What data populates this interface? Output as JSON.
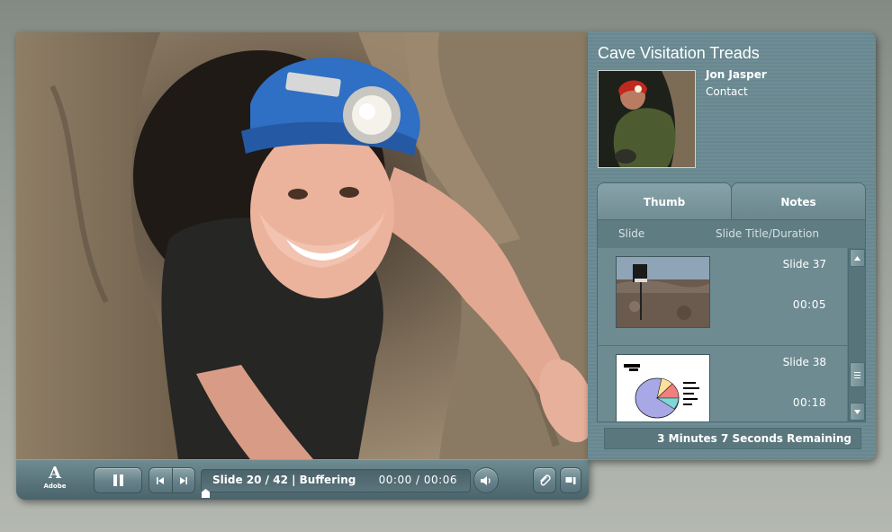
{
  "player": {
    "course_title": "Cave Visitation Treads",
    "presenter": {
      "name": "Jon Jasper",
      "contact_label": "Contact"
    },
    "logo": {
      "mark": "A",
      "word": "Adobe"
    },
    "tabs": [
      {
        "label": "Thumb",
        "active": true
      },
      {
        "label": "Notes",
        "active": false
      }
    ],
    "list_headers": {
      "slide": "Slide",
      "title_duration": "Slide Title/Duration"
    },
    "slides": [
      {
        "title": "Slide 37",
        "duration": "00:05",
        "thumb": "kiosk-on-rocks"
      },
      {
        "title": "Slide 38",
        "duration": "00:18",
        "thumb": "pie-chart"
      }
    ],
    "remaining": "3 Minutes 7 Seconds Remaining",
    "playbar": {
      "slide_status": "Slide 20 / 42 | Buffering",
      "time": "00:00 / 00:06",
      "progress": 0.0
    },
    "icons": {
      "pause": "pause-icon",
      "prev": "previous-slide-icon",
      "next": "next-slide-icon",
      "audio": "speaker-icon",
      "attachment": "paperclip-icon",
      "toggle": "panel-toggle-icon"
    },
    "colors": {
      "panel": "#6e8d94",
      "playbar": "#587279",
      "text": "#ffffff"
    }
  }
}
